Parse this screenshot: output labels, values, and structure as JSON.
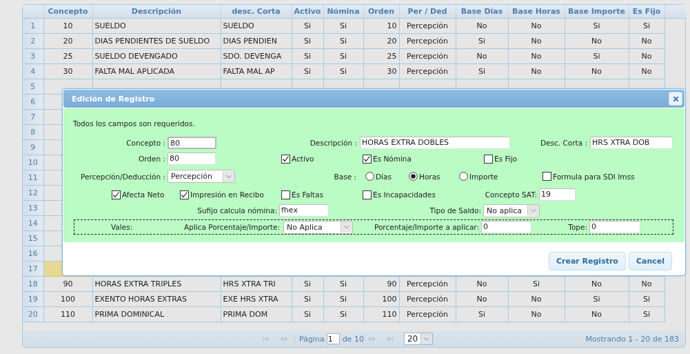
{
  "grid": {
    "columns": [
      "Concepto",
      "Descripción",
      "desc. Corta",
      "Activo",
      "Nómina",
      "Orden",
      "Per / Ded",
      "Base Días",
      "Base Horas",
      "Base Importe",
      "Es Fijo"
    ],
    "rows": [
      {
        "number": "1",
        "selected": false,
        "cells": [
          "10",
          "SUELDO",
          "SUELDO",
          "Si",
          "Si",
          "10",
          "Percepción",
          "No",
          "No",
          "Si",
          "Si"
        ]
      },
      {
        "number": "2",
        "selected": false,
        "cells": [
          "20",
          "DIAS PENDIENTES DE SUELDO",
          "DIAS PENDIEN",
          "Si",
          "Si",
          "20",
          "Percepción",
          "Si",
          "No",
          "No",
          "No"
        ]
      },
      {
        "number": "3",
        "selected": false,
        "cells": [
          "25",
          "SUELDO DEVENGADO",
          "SDO. DEVENGA",
          "Si",
          "Si",
          "25",
          "Percepción",
          "No",
          "No",
          "Si",
          "No"
        ]
      },
      {
        "number": "4",
        "selected": false,
        "cells": [
          "30",
          "FALTA MAL APLICADA",
          "FALTA MAL AP",
          "Si",
          "Si",
          "30",
          "Percepción",
          "Si",
          "No",
          "No",
          "No"
        ]
      },
      {
        "number": "5",
        "selected": false
      },
      {
        "number": "6",
        "selected": false
      },
      {
        "number": "7",
        "selected": false
      },
      {
        "number": "8",
        "selected": false
      },
      {
        "number": "9",
        "selected": false
      },
      {
        "number": "10",
        "selected": false
      },
      {
        "number": "11",
        "selected": false
      },
      {
        "number": "12",
        "selected": false
      },
      {
        "number": "13",
        "selected": false
      },
      {
        "number": "14",
        "selected": false
      },
      {
        "number": "15",
        "selected": false
      },
      {
        "number": "16",
        "selected": false
      },
      {
        "number": "17",
        "selected": true
      },
      {
        "number": "18",
        "selected": false,
        "cells": [
          "90",
          "HORAS EXTRA TRIPLES",
          "HRS XTRA TRI",
          "Si",
          "Si",
          "90",
          "Percepción",
          "No",
          "Si",
          "No",
          "No"
        ]
      },
      {
        "number": "19",
        "selected": false,
        "cells": [
          "100",
          "EXENTO HORAS EXTRAS",
          "EXE HRS XTRA",
          "Si",
          "Si",
          "100",
          "Percepción",
          "No",
          "No",
          "Si",
          "Si"
        ]
      },
      {
        "number": "20",
        "selected": false,
        "cells": [
          "110",
          "PRIMA DOMINICAL",
          "PRIMA DOM",
          "Si",
          "Si",
          "110",
          "Percepción",
          "Si",
          "No",
          "No",
          "Si"
        ]
      }
    ]
  },
  "pager": {
    "page_label": "Página",
    "page": "1",
    "of_pages": "de 10",
    "page_size": "20",
    "summary": "Mostrando 1 - 20 de 183"
  },
  "dialog": {
    "title": "Edición de Registro",
    "note": "Todos los campos son requeridos.",
    "concepto": {
      "label": "Concepto :",
      "value": "80"
    },
    "descripcion": {
      "label": "Descripción :",
      "value": "HORAS EXTRA DOBLES"
    },
    "desc_corta": {
      "label": "Desc. Corta :",
      "value": "HRS XTRA DOB"
    },
    "orden": {
      "label": "Orden :",
      "value": "80"
    },
    "activo": {
      "label": "Activo",
      "checked": true
    },
    "es_nomina": {
      "label": "Es Nómina",
      "checked": true
    },
    "es_fijo": {
      "label": "Es Fijo",
      "checked": false
    },
    "per_ded": {
      "label": "Percepción/Deducción :",
      "value": "Percepción"
    },
    "base": {
      "label": "Base :",
      "options": [
        {
          "label": "Días",
          "selected": false
        },
        {
          "label": "Horas",
          "selected": true
        },
        {
          "label": "Importe",
          "selected": false
        }
      ]
    },
    "formula_sdi": {
      "label": "Formula para SDI Imss",
      "checked": false
    },
    "afecta_neto": {
      "label": "Afecta Neto",
      "checked": true
    },
    "impresion": {
      "label": "Impresión en Recibo",
      "checked": true
    },
    "es_faltas": {
      "label": "Es Faltas",
      "checked": false
    },
    "es_incapacidades": {
      "label": "Es Incapacidades",
      "checked": false
    },
    "concepto_sat": {
      "label": "Concepto SAT:",
      "value": "19"
    },
    "sufijo": {
      "label": "Sufijo calcula nómina:",
      "value": "fhex"
    },
    "tipo_saldo": {
      "label": "Tipo de Saldo:",
      "value": "No aplica"
    },
    "vales": {
      "label": "Vales:"
    },
    "aplica": {
      "label": "Aplica Porcentaje/Importe:",
      "value": "No Aplica"
    },
    "porcentaje": {
      "label": "Porcentaje/Importe a aplicar:",
      "value": "0"
    },
    "tope": {
      "label": "Tope:",
      "value": "0"
    },
    "buttons": [
      "Crear Registro",
      "Cancel"
    ]
  }
}
